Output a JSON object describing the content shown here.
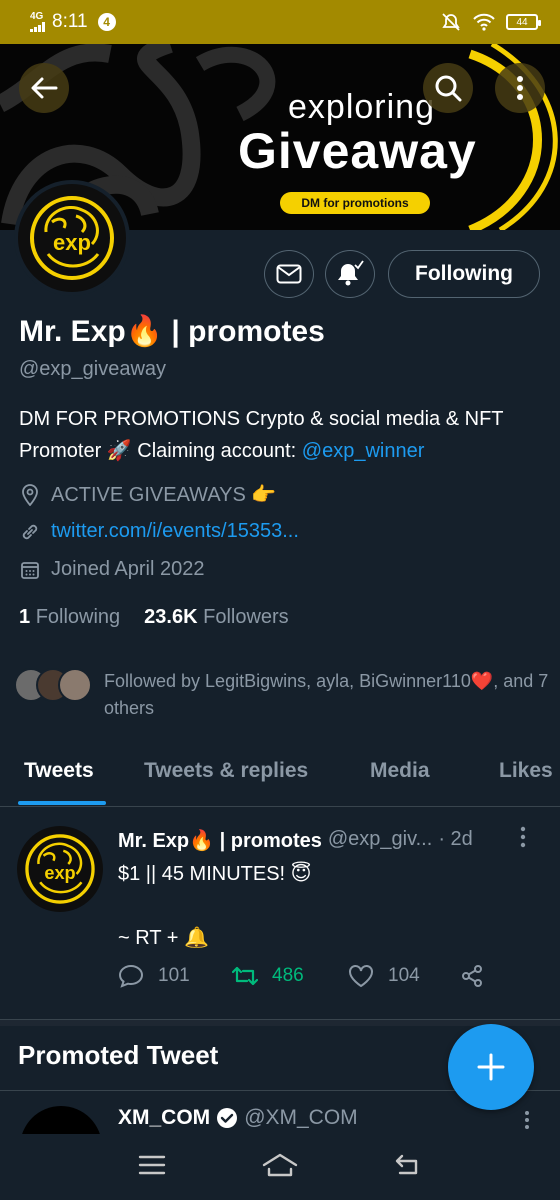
{
  "status_bar": {
    "network": "4G",
    "time": "8:11",
    "notification_count": "4",
    "battery": "44"
  },
  "banner": {
    "line1": "exploring",
    "line2": "Giveaway",
    "tag": "DM for promotions",
    "accent_color": "#f5d000"
  },
  "avatar": {
    "logo_text": "exp"
  },
  "actions": {
    "follow_label": "Following"
  },
  "profile": {
    "name": "Mr. Exp🔥 | promotes",
    "handle": "@exp_giveaway",
    "bio_text": "DM FOR PROMOTIONS Crypto & social media & NFT Promoter 🚀 Claiming account: ",
    "bio_link": "@exp_winner",
    "location": "ACTIVE GIVEAWAYS 👉",
    "website": "twitter.com/i/events/15353...",
    "joined": "Joined April 2022",
    "following_count": "1",
    "following_label": "Following",
    "followers_count": "23.6K",
    "followers_label": "Followers",
    "followed_by": "Followed by LegitBigwins, ayla, BiGwinner110❤️, and 7 others"
  },
  "tabs": [
    {
      "label": "Tweets",
      "active": true
    },
    {
      "label": "Tweets & replies"
    },
    {
      "label": "Media"
    },
    {
      "label": "Likes"
    }
  ],
  "tweet": {
    "name": "Mr. Exp🔥 | promotes",
    "handle": "@exp_giv...",
    "time": "· 2d",
    "text": "$1 || 45 MINUTES! 😇\n\n~ RT + 🔔",
    "replies": "101",
    "retweets": "486",
    "likes": "104"
  },
  "promoted": {
    "title": "Promoted Tweet",
    "name": "XM_COM",
    "handle": "@XM_COM"
  },
  "icons": [
    "back-arrow-icon",
    "search-icon",
    "more-vertical-icon",
    "mail-icon",
    "bell-icon",
    "location-icon",
    "link-icon",
    "calendar-icon",
    "reply-icon",
    "retweet-icon",
    "like-icon",
    "share-icon",
    "verified-icon",
    "compose-plus-icon",
    "menu-icon",
    "home-icon",
    "back-icon"
  ]
}
